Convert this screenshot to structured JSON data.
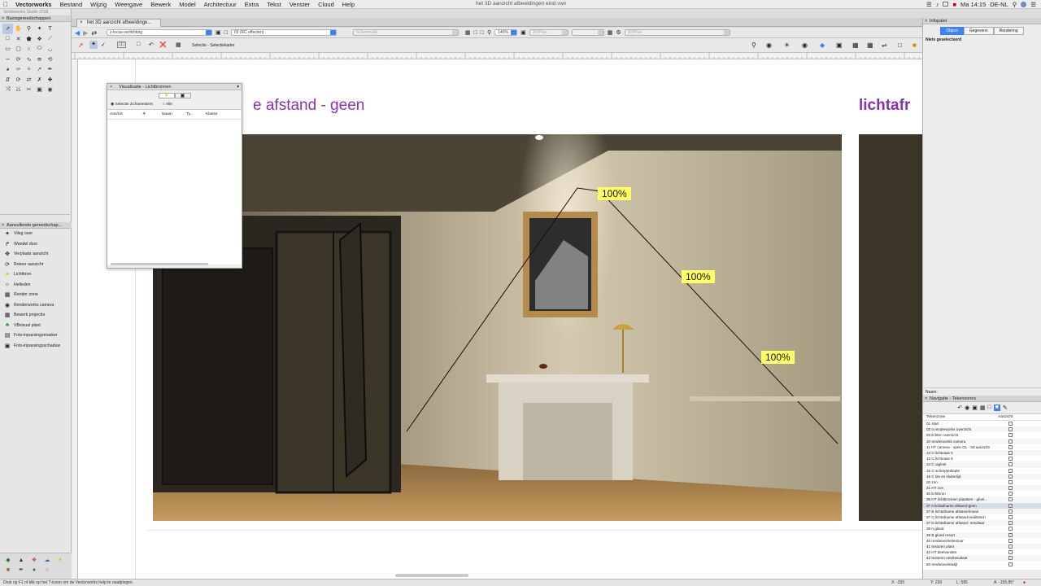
{
  "menubar": {
    "app": "Vectorworks",
    "items": [
      "Bestand",
      "Wijzig",
      "Weergave",
      "Bewerk",
      "Model",
      "Architectuur",
      "Extra",
      "Tekst",
      "Venster",
      "Cloud",
      "Help"
    ],
    "window_title": "het 3D aanzicht afbeeldingen eind.vwx",
    "clock": "Ma 14:15",
    "locale": "DE-NL"
  },
  "left": {
    "app_version": "Vectorworks Studio 2018",
    "palette1_title": "Basisgereedschappen",
    "palette2_title": "Aanvullende gereedschap...",
    "tools2": [
      {
        "label": "Vlieg over",
        "icon": "fly-over-icon"
      },
      {
        "label": "Wandel door",
        "icon": "walkthrough-icon"
      },
      {
        "label": "Verplaats aanzicht",
        "icon": "move-view-icon"
      },
      {
        "label": "Roteer aanzicht",
        "icon": "rotate-view-icon"
      },
      {
        "label": "Lichtbron",
        "icon": "light-source-icon"
      },
      {
        "label": "Helleden",
        "icon": "heliodon-icon"
      },
      {
        "label": "Render zone",
        "icon": "render-zone-icon"
      },
      {
        "label": "Renderworks camera",
        "icon": "camera-icon"
      },
      {
        "label": "Bewerk projectie",
        "icon": "edit-projection-icon"
      },
      {
        "label": "VBvisual plant",
        "icon": "plant-icon"
      },
      {
        "label": "Foto-inpassingsmasker",
        "icon": "photo-mask-icon"
      },
      {
        "label": "Foto-inpassingsschaduw",
        "icon": "photo-shadow-icon"
      }
    ]
  },
  "document": {
    "tab_label": "het 3D aanzicht afbeeldinge...",
    "viewbar": {
      "plane": "z-locus-verlichting",
      "view": "03 (RC effecten)",
      "render": "Schermvlak",
      "zoom": "140%",
      "layer_plane": "3D/Plan",
      "layer_plane2": "3D/Plan"
    },
    "mode_label": "Selectie - Selectiekader",
    "slide_title_left": "e afstand - geen",
    "slide_title_right": "lichtafr",
    "badges": [
      "100%",
      "100%",
      "100%"
    ]
  },
  "viz_dialog": {
    "title": "Visualisatie - Lichtbronnen",
    "radio_options": [
      "Selectie zichtvensters",
      "Alle"
    ],
    "columns": [
      "Aan/Uit",
      "Naam",
      "Ty...",
      "Klasse"
    ]
  },
  "status_bar": {
    "hint": "Druk op F1 of klik op het ?-icoon om de Vectorworks help te raadplegen.",
    "coords": [
      "X: -335",
      "Y: 239",
      "L: 585",
      "A: -155.85°"
    ]
  },
  "right": {
    "info_title": "Infopalet",
    "info_tabs": [
      "Object",
      "Gegevens",
      "Rendering"
    ],
    "info_status": "Niets geselecteerd",
    "name_label": "Naam:",
    "nav_title": "Navigatie - Tekenzones",
    "nav_columns": [
      "Tekenzone",
      "Aanzicht"
    ],
    "nav_rows": [
      "01 start",
      "03 a renderworks overzicht",
      "03 lichten overzicht",
      "10 renderworks camera",
      "11 HT camera - open GL - 3d aanzicht",
      "13 C lichtvaas 0",
      "13 C lichtvaas 5",
      "14 C uiglnst",
      "15 C scherptediepte",
      "16 C las en sluiterlijd",
      "20 zon",
      "21 HT zon",
      "30 lichtbron",
      "36 HT lichtbronnen plaatsen - gloei...",
      "37 A lichtafname afstand-geen",
      "37 B lichtafname afstand-lineair",
      "37 C lichtafname afstand-realistisch",
      "37 D lichtafname afstand- resultaat",
      "38 A gloed",
      "38 B gloed resort",
      "40 renderworkstextuur",
      "41 texturen plant",
      "42 HT deelvenster",
      "42 texturen eindresultaat",
      "50 renderworksstijl"
    ],
    "nav_selected_index": 14
  }
}
